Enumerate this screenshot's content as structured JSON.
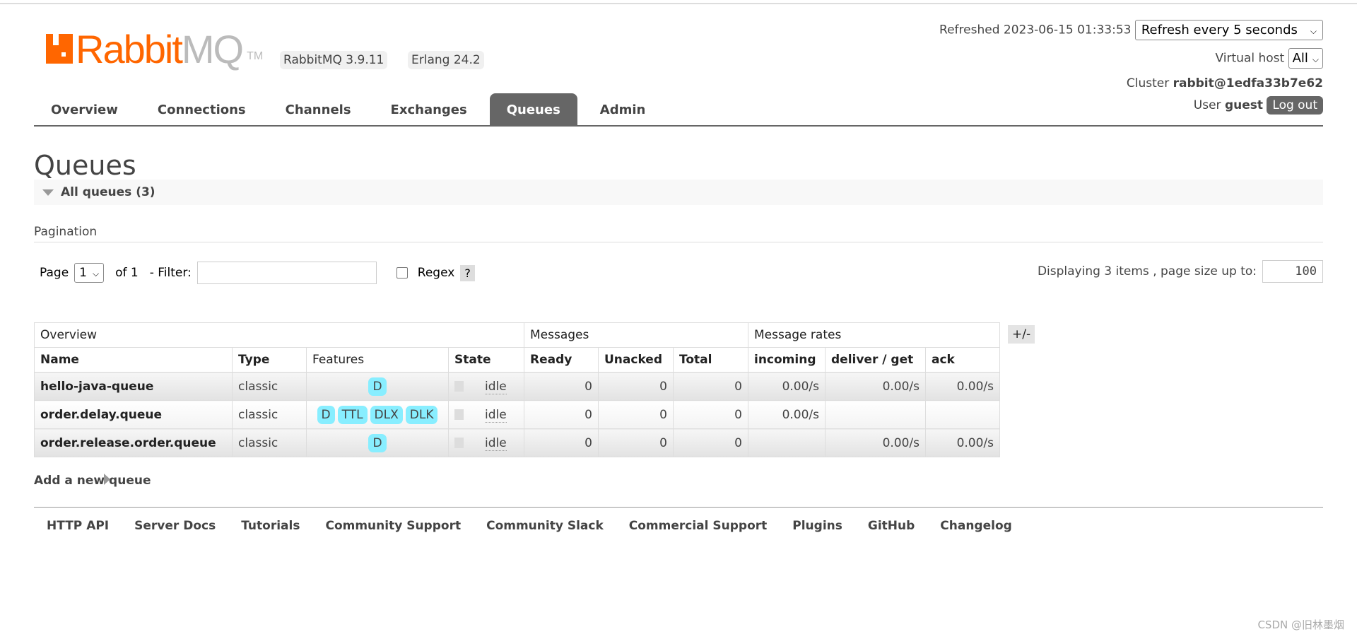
{
  "logo": {
    "text_orange": "Rabbit",
    "text_gray": "MQ",
    "tm": "TM"
  },
  "versions": {
    "rabbitmq": "RabbitMQ 3.9.11",
    "erlang": "Erlang 24.2"
  },
  "header": {
    "refreshed_label": "Refreshed 2023-06-15 01:33:53",
    "refresh_select": "Refresh every 5 seconds",
    "vhost_label": "Virtual host",
    "vhost_select": "All",
    "cluster_label": "Cluster",
    "cluster_name": "rabbit@1edfa33b7e62",
    "user_label": "User",
    "user_name": "guest",
    "logout": "Log out"
  },
  "tabs": [
    {
      "label": "Overview"
    },
    {
      "label": "Connections"
    },
    {
      "label": "Channels"
    },
    {
      "label": "Exchanges"
    },
    {
      "label": "Queues",
      "active": true
    },
    {
      "label": "Admin"
    }
  ],
  "page_title": "Queues",
  "section": "All queues (3)",
  "pagination": {
    "title": "Pagination",
    "page_label": "Page",
    "page_value": "1",
    "of": "of 1",
    "filter_label": "- Filter:",
    "filter_value": "",
    "regex_label": "Regex",
    "help": "?",
    "displaying": "Displaying 3 items , page size up to:",
    "page_size": "100"
  },
  "table": {
    "groups": [
      "Overview",
      "Messages",
      "Message rates"
    ],
    "columns": [
      "Name",
      "Type",
      "Features",
      "State",
      "Ready",
      "Unacked",
      "Total",
      "incoming",
      "deliver / get",
      "ack"
    ],
    "rows": [
      {
        "name": "hello-java-queue",
        "type": "classic",
        "features": [
          "D"
        ],
        "state": "idle",
        "ready": "0",
        "unacked": "0",
        "total": "0",
        "incoming": "0.00/s",
        "deliver": "0.00/s",
        "ack": "0.00/s"
      },
      {
        "name": "order.delay.queue",
        "type": "classic",
        "features": [
          "D",
          "TTL",
          "DLX",
          "DLK"
        ],
        "state": "idle",
        "ready": "0",
        "unacked": "0",
        "total": "0",
        "incoming": "0.00/s",
        "deliver": "",
        "ack": ""
      },
      {
        "name": "order.release.order.queue",
        "type": "classic",
        "features": [
          "D"
        ],
        "state": "idle",
        "ready": "0",
        "unacked": "0",
        "total": "0",
        "incoming": "",
        "deliver": "0.00/s",
        "ack": "0.00/s"
      }
    ],
    "toggle": "+/-"
  },
  "add_queue": "Add a new queue",
  "footer": [
    "HTTP API",
    "Server Docs",
    "Tutorials",
    "Community Support",
    "Community Slack",
    "Commercial Support",
    "Plugins",
    "GitHub",
    "Changelog"
  ],
  "watermark": "CSDN @旧林墨烟",
  "colors": {
    "brand": "#ff6600",
    "tab_active": "#666666",
    "feature_badge": "#88eeff"
  }
}
